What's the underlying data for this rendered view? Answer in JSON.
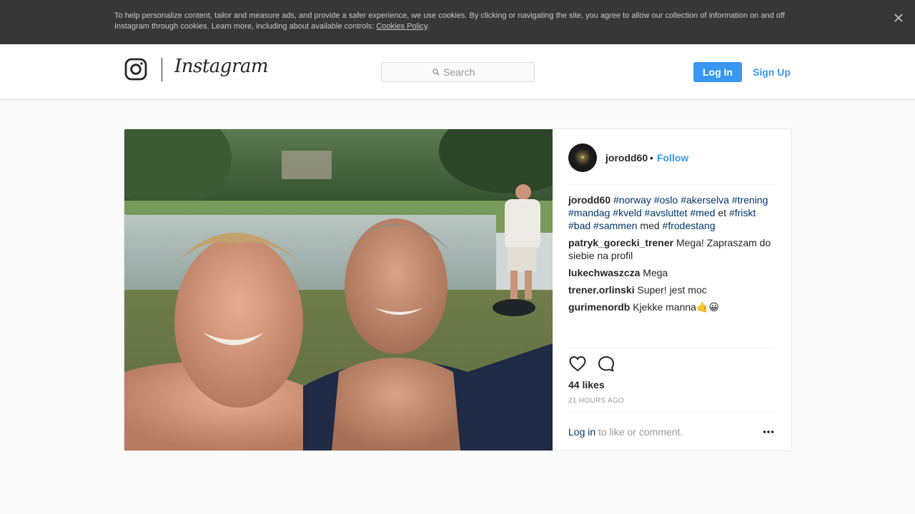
{
  "cookie_banner": {
    "text": "To help personalize content, tailor and measure ads, and provide a safer experience, we use cookies. By clicking or navigating the site, you agree to allow our collection of information on and off Instagram through cookies. Learn more, including about available controls: ",
    "link": "Cookies Policy",
    "after_link": "."
  },
  "header": {
    "logo": "Instagram",
    "search_placeholder": "Search",
    "login_label": "Log In",
    "signup_label": "Sign Up"
  },
  "post": {
    "owner": "jorodd60",
    "separator": "•",
    "follow_label": "Follow",
    "caption": [
      {
        "t": "#norway",
        "tag": true
      },
      {
        "t": " ",
        "tag": false
      },
      {
        "t": "#oslo",
        "tag": true
      },
      {
        "t": " ",
        "tag": false
      },
      {
        "t": "#akerselva",
        "tag": true
      },
      {
        "t": " ",
        "tag": false
      },
      {
        "t": "#trening",
        "tag": true
      },
      {
        "t": " ",
        "tag": false
      },
      {
        "t": "#mandag",
        "tag": true
      },
      {
        "t": " ",
        "tag": false
      },
      {
        "t": "#kveld",
        "tag": true
      },
      {
        "t": " ",
        "tag": false
      },
      {
        "t": "#avsluttet",
        "tag": true
      },
      {
        "t": " ",
        "tag": false
      },
      {
        "t": "#med",
        "tag": true
      },
      {
        "t": " et ",
        "tag": false
      },
      {
        "t": "#friskt",
        "tag": true
      },
      {
        "t": " ",
        "tag": false
      },
      {
        "t": "#bad",
        "tag": true
      },
      {
        "t": " ",
        "tag": false
      },
      {
        "t": "#sammen",
        "tag": true
      },
      {
        "t": " med ",
        "tag": false
      },
      {
        "t": "#frodestang",
        "tag": true
      }
    ],
    "comments": [
      {
        "user": "patryk_gorecki_trener",
        "text": "Mega! Zapraszam do siebie na profil"
      },
      {
        "user": "lukechwaszcza",
        "text": "Mega"
      },
      {
        "user": "trener.orlinski",
        "text": "Super! jest moc"
      },
      {
        "user": "gurimenordb",
        "text": "Kjekke manna🤙😀"
      }
    ],
    "likes": "44 likes",
    "time": "21 HOURS AGO",
    "login_prompt": {
      "link": "Log in",
      "rest": " to like or comment."
    }
  },
  "icons": {
    "close": "close-icon",
    "logo_glyph": "instagram-glyph-icon",
    "search": "search-icon",
    "like": "heart-icon",
    "comment": "speech-bubble-icon",
    "more": "more-options-icon"
  },
  "colors": {
    "accent": "#3897f0",
    "link_dark": "#003569",
    "banner_bg": "#373737"
  }
}
